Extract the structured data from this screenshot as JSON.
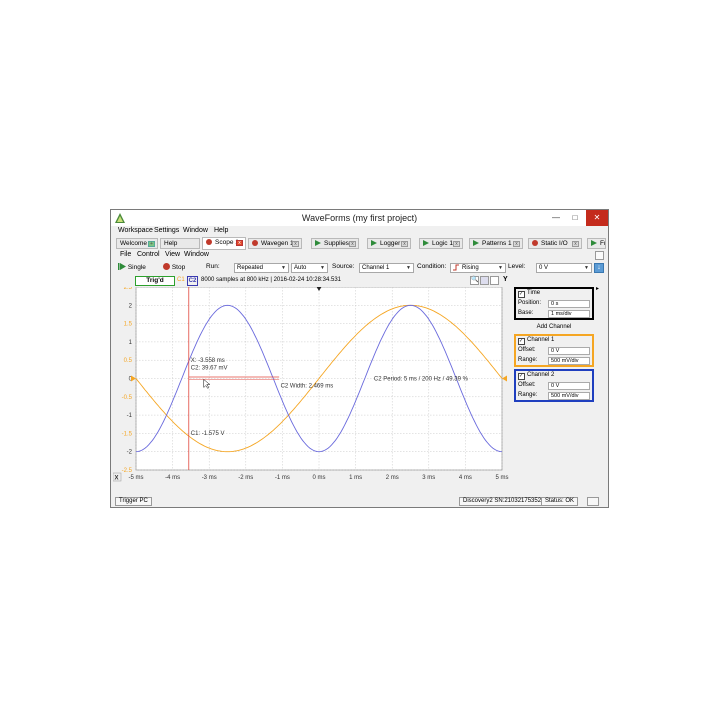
{
  "window": {
    "title": "WaveForms   (my first project)",
    "minimize": "—",
    "maximize": "□",
    "close": "✕"
  },
  "menu": [
    "Workspace",
    "Settings",
    "Window",
    "Help"
  ],
  "tabs": [
    {
      "label": "Welcome"
    },
    {
      "label": "Help"
    },
    {
      "label": "Scope 1"
    },
    {
      "label": "Wavegen 1"
    },
    {
      "label": "Supplies"
    },
    {
      "label": "Logger"
    },
    {
      "label": "Logic 1"
    },
    {
      "label": "Patterns 1"
    },
    {
      "label": "Static I/O"
    },
    {
      "label": "Fr"
    }
  ],
  "scope_menu": [
    "File",
    "Control",
    "View",
    "Window"
  ],
  "toolbar": {
    "single": "Single",
    "stop": "Stop",
    "run_label": "Run:",
    "run_mode": "Repeated",
    "run_auto": "Auto",
    "source_label": "Source:",
    "source": "Channel 1",
    "condition_label": "Condition:",
    "condition": "Rising",
    "level_label": "Level:",
    "level": "0 V"
  },
  "info": {
    "trig": "Trig'd",
    "c1": "C1",
    "c2": "C2",
    "samples": "8000 samples at 800 kHz | 2016-02-24 10:28:34.531"
  },
  "plot": {
    "y_ticks": [
      "2.5",
      "2",
      "1.5",
      "1",
      "0.5",
      "0",
      "-0.5",
      "-1",
      "-1.5",
      "-2",
      "-2.5"
    ],
    "x_ticks": [
      "-5 ms",
      "-4 ms",
      "-3 ms",
      "-2 ms",
      "-1 ms",
      "0 ms",
      "1 ms",
      "2 ms",
      "3 ms",
      "4 ms",
      "5 ms"
    ],
    "x_axis_label": "X",
    "cursor_x": "X: -3.558 ms",
    "cursor_c2": "C2: 39.67 mV",
    "c1_level": "C1: -1.575 V",
    "c2_width": "C2 Width: 2.469 ms",
    "c2_period": "C2 Period: 5 ms / 200 Hz / 49.39 %",
    "colors": {
      "c1": "#f5a623",
      "c2": "#6b6bdd",
      "cursor": "#e0463c",
      "grid": "#c8c8c8"
    }
  },
  "chart_data": {
    "type": "line",
    "xlabel": "",
    "ylabel": "",
    "xlim": [
      -5,
      5
    ],
    "ylim": [
      -2.5,
      2.5
    ],
    "series": [
      {
        "name": "C1",
        "x": [
          -5,
          -4.375,
          -3.75,
          -3.125,
          -2.5,
          -1.875,
          -1.25,
          -0.625,
          0,
          0.625,
          1.25,
          1.875,
          2.5,
          3.125,
          3.75,
          4.375,
          5
        ],
        "y": [
          0,
          -0.77,
          -1.41,
          -1.85,
          -2.0,
          -1.85,
          -1.41,
          -0.77,
          0,
          0.77,
          1.41,
          1.85,
          2.0,
          1.85,
          1.41,
          0.77,
          0
        ]
      },
      {
        "name": "C2",
        "x": [
          -5,
          -4.6875,
          -4.375,
          -4.0625,
          -3.75,
          -3.4375,
          -3.125,
          -2.8125,
          -2.5,
          -2.1875,
          -1.875,
          -1.5625,
          -1.25,
          -0.9375,
          -0.625,
          -0.3125,
          0,
          0.3125,
          0.625,
          0.9375,
          1.25,
          1.5625,
          1.875,
          2.1875,
          2.5,
          2.8125,
          3.125,
          3.4375,
          3.75,
          4.0625,
          4.375,
          4.6875,
          5
        ],
        "y": [
          -2.0,
          -1.85,
          -1.41,
          -0.77,
          0,
          0.77,
          1.41,
          1.85,
          2.0,
          1.85,
          1.41,
          0.77,
          0,
          -0.77,
          -1.41,
          -1.85,
          -2.0,
          -1.85,
          -1.41,
          -0.77,
          0,
          0.77,
          1.41,
          1.85,
          2.0,
          1.85,
          1.41,
          0.77,
          0,
          -0.77,
          -1.41,
          -1.85,
          -2.0
        ]
      }
    ]
  },
  "right_panel": {
    "time": {
      "title": "Time",
      "position_label": "Position:",
      "position": "0 s",
      "base_label": "Base:",
      "base": "1 ms/div"
    },
    "add_channel": "Add Channel",
    "ch1": {
      "title": "Channel 1",
      "offset_label": "Offset:",
      "offset": "0 V",
      "range_label": "Range:",
      "range": "500 mV/div"
    },
    "ch2": {
      "title": "Channel 2",
      "offset_label": "Offset:",
      "offset": "0 V",
      "range_label": "Range:",
      "range": "500 mV/div"
    }
  },
  "status": {
    "trigger_pc": "Trigger PC",
    "device": "Discovery2 SN:210321753524",
    "status": "Status: OK"
  }
}
